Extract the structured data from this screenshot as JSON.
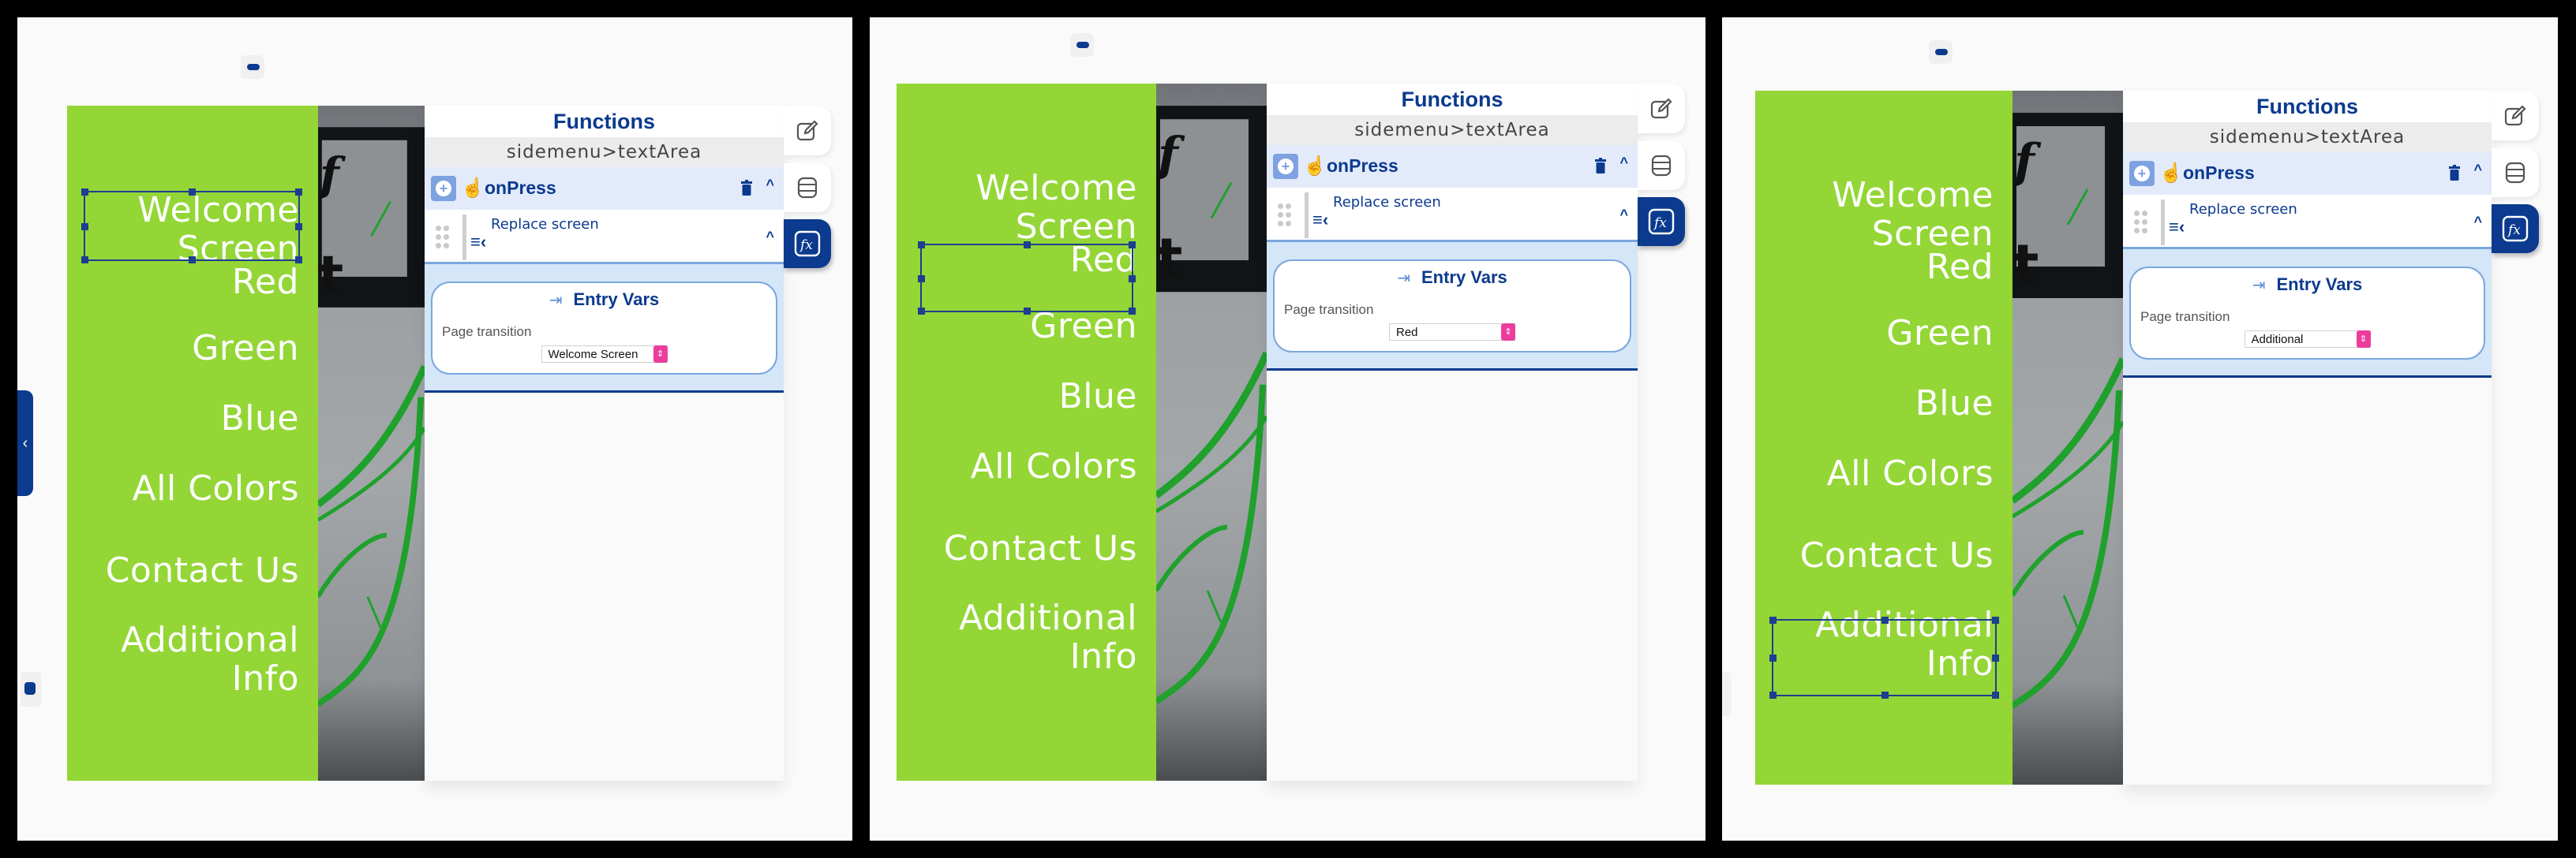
{
  "menu_items": [
    {
      "label": "Welcome Screen",
      "lines": [
        "Welcome",
        "Screen"
      ]
    },
    {
      "label": "Red",
      "lines": [
        "Red"
      ]
    },
    {
      "label": "Green",
      "lines": [
        "Green"
      ]
    },
    {
      "label": "Blue",
      "lines": [
        "Blue"
      ]
    },
    {
      "label": "All Colors",
      "lines": [
        "All Colors"
      ]
    },
    {
      "label": "Contact Us",
      "lines": [
        "Contact Us"
      ]
    },
    {
      "label": "Additional Info",
      "lines": [
        "Additional",
        "Info"
      ]
    }
  ],
  "functions_panel": {
    "title": "Functions",
    "breadcrumb": "sidemenu>textArea",
    "event": "onPress",
    "action": "Replace screen",
    "entry_vars_title": "Entry Vars",
    "page_transition_label": "Page transition"
  },
  "panels": [
    {
      "selected_item": "Welcome Screen",
      "page_transition_value": "Welcome Screen"
    },
    {
      "selected_item": "Red",
      "page_transition_value": "Red"
    },
    {
      "selected_item": "Additional Info",
      "page_transition_value": "Additional"
    }
  ],
  "icons": {
    "edit_tab": "edit-icon",
    "data_tab": "database-icon",
    "functions_tab": "fx-icon",
    "add": "plus-circle-icon",
    "event": "hand-pointer-icon",
    "delete": "trash-icon",
    "collapse": "chevron-up-icon",
    "drag": "drag-handle-icon",
    "action": "replace-screen-icon",
    "entry": "sign-in-icon"
  },
  "colors": {
    "menu_background": "#93d636",
    "accent": "#0b3a8e",
    "select_stepper": "#ec3d9c",
    "entry_vars_background": "#d4e6f8"
  }
}
